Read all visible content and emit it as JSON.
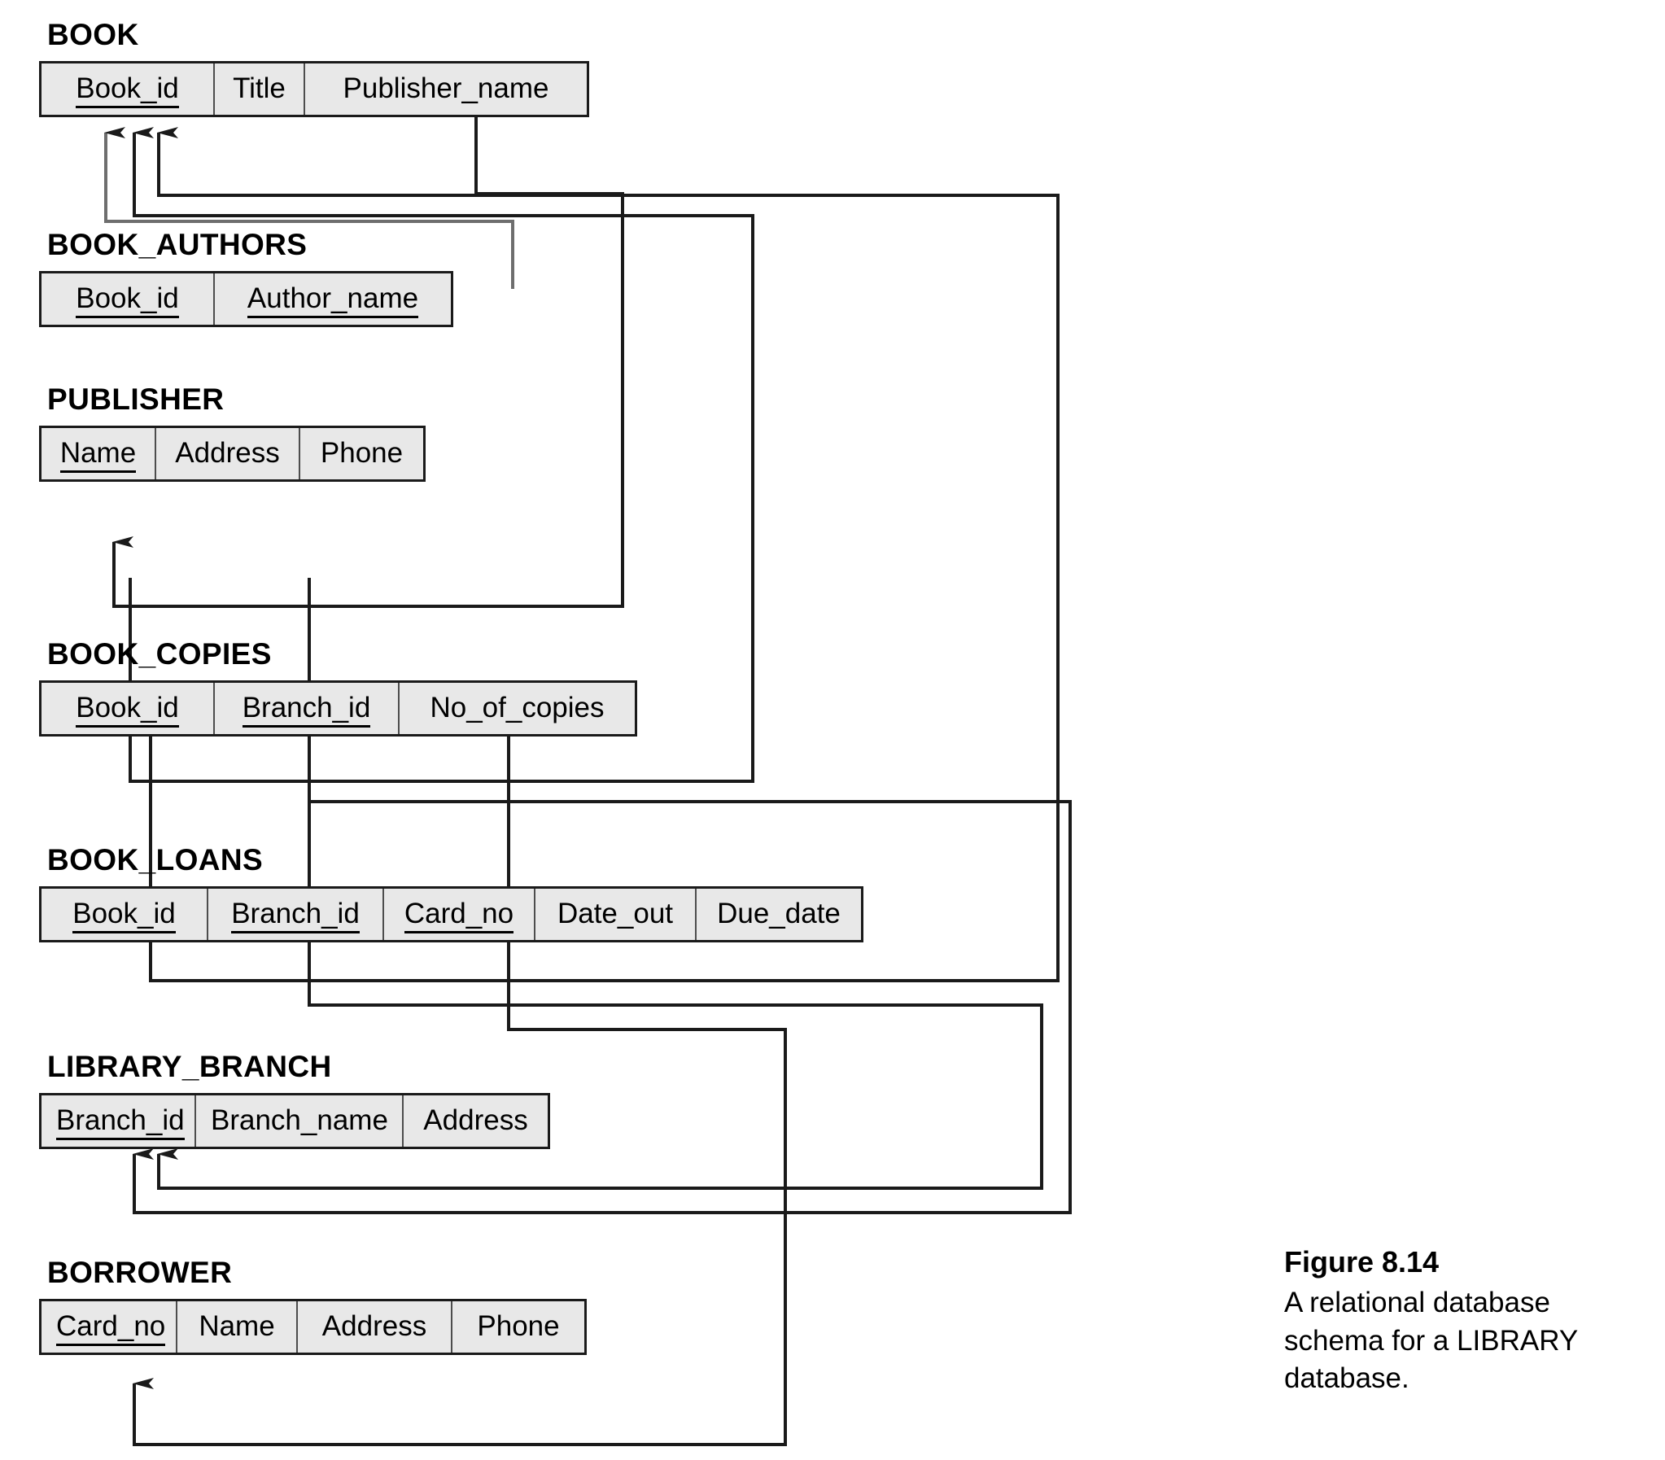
{
  "figure": {
    "title": "Figure 8.14",
    "caption": "A relational database schema for a LIBRARY database."
  },
  "chart_data": {
    "type": "diagram",
    "diagram_kind": "relational-database-schema",
    "title": "A relational database schema for a LIBRARY database.",
    "relations": [
      {
        "name": "BOOK",
        "attributes": [
          {
            "name": "Book_id",
            "primary_key": true
          },
          {
            "name": "Title",
            "primary_key": false
          },
          {
            "name": "Publisher_name",
            "primary_key": false
          }
        ]
      },
      {
        "name": "BOOK_AUTHORS",
        "attributes": [
          {
            "name": "Book_id",
            "primary_key": true
          },
          {
            "name": "Author_name",
            "primary_key": true
          }
        ]
      },
      {
        "name": "PUBLISHER",
        "attributes": [
          {
            "name": "Name",
            "primary_key": true
          },
          {
            "name": "Address",
            "primary_key": false
          },
          {
            "name": "Phone",
            "primary_key": false
          }
        ]
      },
      {
        "name": "BOOK_COPIES",
        "attributes": [
          {
            "name": "Book_id",
            "primary_key": true
          },
          {
            "name": "Branch_id",
            "primary_key": true
          },
          {
            "name": "No_of_copies",
            "primary_key": false
          }
        ]
      },
      {
        "name": "BOOK_LOANS",
        "attributes": [
          {
            "name": "Book_id",
            "primary_key": true
          },
          {
            "name": "Branch_id",
            "primary_key": true
          },
          {
            "name": "Card_no",
            "primary_key": true
          },
          {
            "name": "Date_out",
            "primary_key": false
          },
          {
            "name": "Due_date",
            "primary_key": false
          }
        ]
      },
      {
        "name": "LIBRARY_BRANCH",
        "attributes": [
          {
            "name": "Branch_id",
            "primary_key": true
          },
          {
            "name": "Branch_name",
            "primary_key": false
          },
          {
            "name": "Address",
            "primary_key": false
          }
        ]
      },
      {
        "name": "BORROWER",
        "attributes": [
          {
            "name": "Card_no",
            "primary_key": true
          },
          {
            "name": "Name",
            "primary_key": false
          },
          {
            "name": "Address",
            "primary_key": false
          },
          {
            "name": "Phone",
            "primary_key": false
          }
        ]
      }
    ],
    "foreign_keys": [
      {
        "from_relation": "BOOK",
        "from_attribute": "Publisher_name",
        "to_relation": "PUBLISHER",
        "to_attribute": "Name"
      },
      {
        "from_relation": "BOOK_AUTHORS",
        "from_attribute": "Book_id",
        "to_relation": "BOOK",
        "to_attribute": "Book_id"
      },
      {
        "from_relation": "BOOK_COPIES",
        "from_attribute": "Book_id",
        "to_relation": "BOOK",
        "to_attribute": "Book_id"
      },
      {
        "from_relation": "BOOK_COPIES",
        "from_attribute": "Branch_id",
        "to_relation": "LIBRARY_BRANCH",
        "to_attribute": "Branch_id"
      },
      {
        "from_relation": "BOOK_LOANS",
        "from_attribute": "Book_id",
        "to_relation": "BOOK",
        "to_attribute": "Book_id"
      },
      {
        "from_relation": "BOOK_LOANS",
        "from_attribute": "Branch_id",
        "to_relation": "LIBRARY_BRANCH",
        "to_attribute": "Branch_id"
      },
      {
        "from_relation": "BOOK_LOANS",
        "from_attribute": "Card_no",
        "to_relation": "BORROWER",
        "to_attribute": "Card_no"
      }
    ],
    "notation": {
      "primary_key": "underlined attribute name",
      "foreign_key": "arrow from referencing attribute to referenced primary key"
    }
  }
}
